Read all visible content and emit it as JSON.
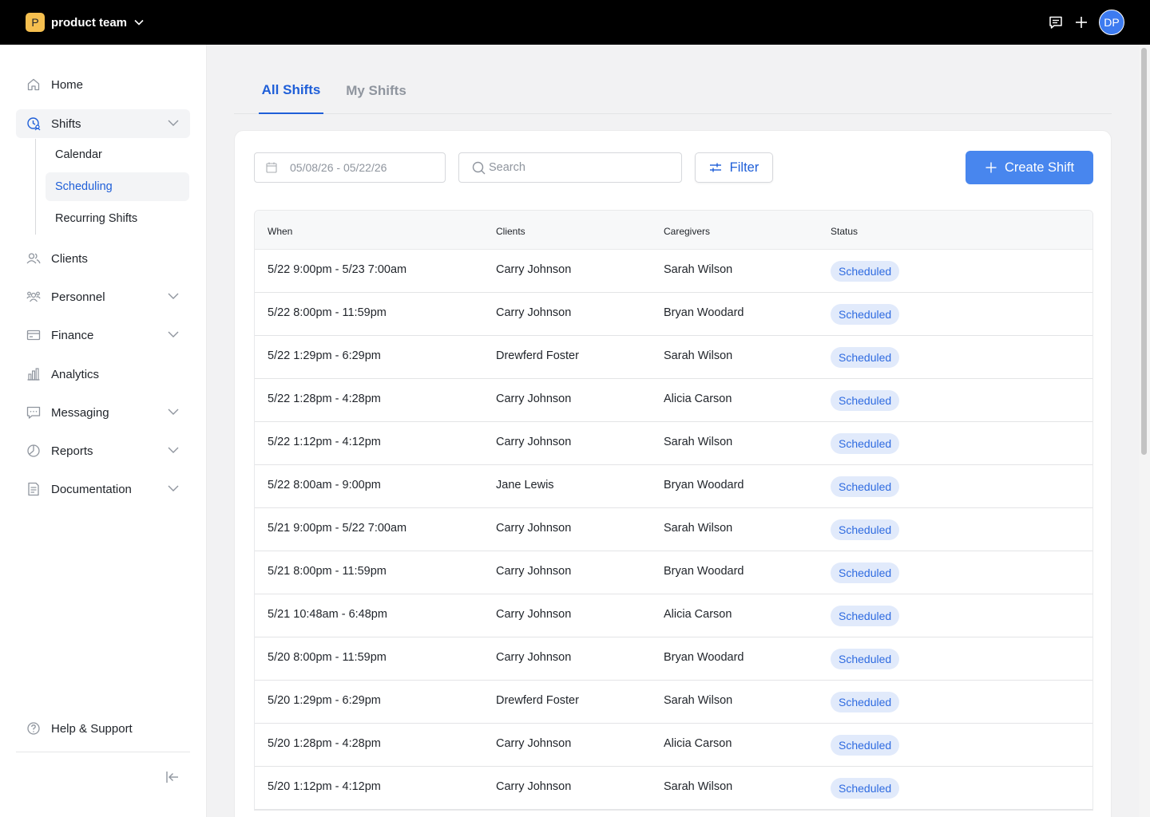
{
  "topbar": {
    "org_initial": "P",
    "org_name": "product team",
    "avatar_initials": "DP",
    "brand_color": "#f5bf4f"
  },
  "sidebar": {
    "items": [
      {
        "label": "Home",
        "icon": "home-icon"
      },
      {
        "label": "Shifts",
        "icon": "clock-user-icon",
        "expanded": true
      },
      {
        "label": "Clients",
        "icon": "users-icon"
      },
      {
        "label": "Personnel",
        "icon": "team-icon"
      },
      {
        "label": "Finance",
        "icon": "card-icon"
      },
      {
        "label": "Analytics",
        "icon": "bar-chart-icon"
      },
      {
        "label": "Messaging",
        "icon": "message-icon"
      },
      {
        "label": "Reports",
        "icon": "pie-chart-icon"
      },
      {
        "label": "Documentation",
        "icon": "document-icon"
      }
    ],
    "shifts_sub": [
      "Calendar",
      "Scheduling",
      "Recurring Shifts"
    ],
    "active_sub": "Scheduling",
    "help_label": "Help & Support"
  },
  "tabs": [
    {
      "label": "All Shifts",
      "active": true
    },
    {
      "label": "My Shifts",
      "active": false
    }
  ],
  "toolbar": {
    "date_range": "05/08/26 - 05/22/26",
    "search_placeholder": "Search",
    "filter_label": "Filter",
    "create_label": "Create Shift",
    "accent": "#4886ee"
  },
  "table": {
    "columns": [
      "When",
      "Clients",
      "Caregivers",
      "Status"
    ],
    "rows": [
      {
        "when": "5/22 9:00pm - 5/23 7:00am",
        "client": "Carry Johnson",
        "caregiver": "Sarah Wilson",
        "status": "Scheduled"
      },
      {
        "when": "5/22 8:00pm - 11:59pm",
        "client": "Carry Johnson",
        "caregiver": "Bryan Woodard",
        "status": "Scheduled"
      },
      {
        "when": "5/22 1:29pm - 6:29pm",
        "client": "Drewferd Foster",
        "caregiver": "Sarah Wilson",
        "status": "Scheduled"
      },
      {
        "when": "5/22 1:28pm - 4:28pm",
        "client": "Carry Johnson",
        "caregiver": "Alicia Carson",
        "status": "Scheduled"
      },
      {
        "when": "5/22 1:12pm - 4:12pm",
        "client": "Carry Johnson",
        "caregiver": "Sarah Wilson",
        "status": "Scheduled"
      },
      {
        "when": "5/22 8:00am - 9:00pm",
        "client": "Jane Lewis",
        "caregiver": "Bryan Woodard",
        "status": "Scheduled"
      },
      {
        "when": "5/21 9:00pm - 5/22 7:00am",
        "client": "Carry Johnson",
        "caregiver": "Sarah Wilson",
        "status": "Scheduled"
      },
      {
        "when": "5/21 8:00pm - 11:59pm",
        "client": "Carry Johnson",
        "caregiver": "Bryan Woodard",
        "status": "Scheduled"
      },
      {
        "when": "5/21 10:48am - 6:48pm",
        "client": "Carry Johnson",
        "caregiver": "Alicia Carson",
        "status": "Scheduled"
      },
      {
        "when": "5/20 8:00pm - 11:59pm",
        "client": "Carry Johnson",
        "caregiver": "Bryan Woodard",
        "status": "Scheduled"
      },
      {
        "when": "5/20 1:29pm - 6:29pm",
        "client": "Drewferd Foster",
        "caregiver": "Sarah Wilson",
        "status": "Scheduled"
      },
      {
        "when": "5/20 1:28pm - 4:28pm",
        "client": "Carry Johnson",
        "caregiver": "Alicia Carson",
        "status": "Scheduled"
      },
      {
        "when": "5/20 1:12pm - 4:12pm",
        "client": "Carry Johnson",
        "caregiver": "Sarah Wilson",
        "status": "Scheduled"
      }
    ]
  }
}
